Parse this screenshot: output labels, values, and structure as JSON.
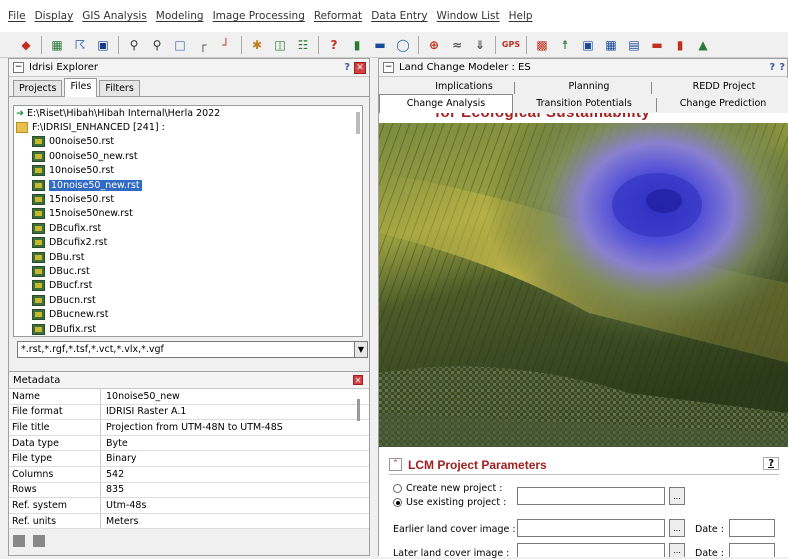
{
  "menu": [
    "File",
    "Display",
    "GIS Analysis",
    "Modeling",
    "Image Processing",
    "Reformat",
    "Data Entry",
    "Window List",
    "Help"
  ],
  "toolbar_icons": [
    "open-icon",
    "compose-icon",
    "shortcut-icon",
    "palette-icon",
    "zoom-in-icon",
    "zoom-out-icon",
    "window-icon",
    "corner-icon",
    "digitize-icon",
    "grid-icon",
    "layout-icon",
    "sort-icon",
    "chart-icon",
    "minus-icon",
    "circle-icon",
    "target-icon",
    "cut-icon",
    "flag-icon",
    "gps-icon",
    "chart-bar-icon",
    "axis-icon",
    "image-icon",
    "table-icon",
    "histogram-icon",
    "bar-icon",
    "red-bar-icon",
    "legend-icon",
    "polygon-icon"
  ],
  "explorer": {
    "title": "Idrisi Explorer",
    "tabs": [
      "Projects",
      "Files",
      "Filters"
    ],
    "selected_tab": "Files",
    "paths": [
      "E:\\Riset\\Hibah\\Hibah Internal\\Herla 2022",
      "F:\\IDRISI_ENHANCED [241] :"
    ],
    "files": [
      "00noise50.rst",
      "00noise50_new.rst",
      "10noise50.rst",
      "10noise50_new.rst",
      "15noise50.rst",
      "15noise50new.rst",
      "DBcufix.rst",
      "DBcufix2.rst",
      "DBu.rst",
      "DBuc.rst",
      "DBucf.rst",
      "DBucn.rst",
      "DBucnew.rst",
      "DBufix.rst"
    ],
    "selected_file": "10noise50_new.rst",
    "filter": "*.rst,*.rgf,*.tsf,*.vct,*.vlx,*.vgf"
  },
  "metadata": {
    "title": "Metadata",
    "rows": [
      {
        "key": "Name",
        "value": "10noise50_new"
      },
      {
        "key": "File format",
        "value": "IDRISI Raster A.1"
      },
      {
        "key": "File title",
        "value": "Projection from UTM-48N to UTM-48S"
      },
      {
        "key": "Data type",
        "value": "Byte"
      },
      {
        "key": "File type",
        "value": "Binary"
      },
      {
        "key": "Columns",
        "value": "542"
      },
      {
        "key": "Rows",
        "value": "835"
      },
      {
        "key": "Ref. system",
        "value": "Utm-48s"
      },
      {
        "key": "Ref. units",
        "value": "Meters"
      }
    ]
  },
  "lcm": {
    "title": "Land Change Modeler : ES",
    "tabs_top": [
      "Implications",
      "Planning",
      "REDD Project"
    ],
    "tabs_bottom": [
      "Change Analysis",
      "Transition Potentials",
      "Change Prediction"
    ],
    "banner_text": "for Ecological Sustainability",
    "params_title": "LCM Project Parameters",
    "help": "?",
    "radio_new": "Create new project :",
    "radio_existing": "Use existing project :",
    "earlier_label": "Earlier land cover image :",
    "later_label": "Later land cover image :",
    "date_label": "Date :",
    "browse": "..."
  },
  "colors": {
    "accent_red": "#a02020",
    "selection_blue": "#316ac5"
  }
}
